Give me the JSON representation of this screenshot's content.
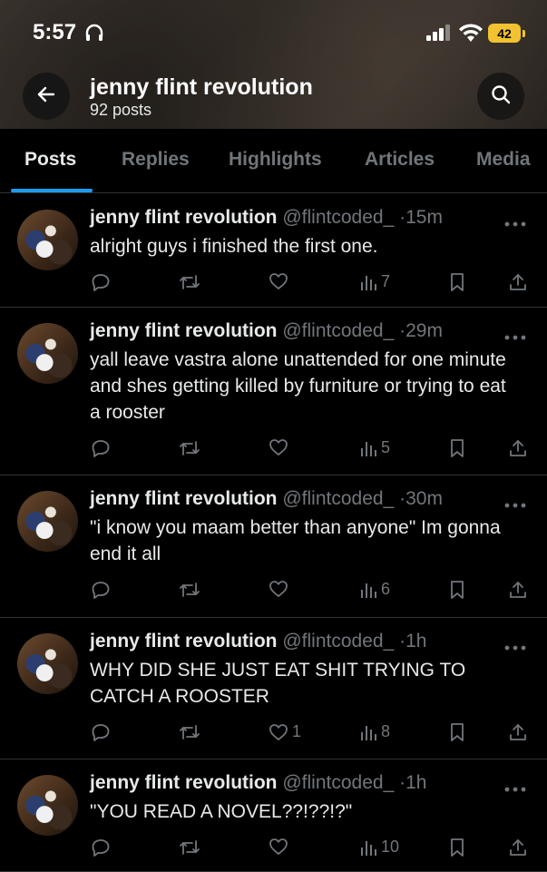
{
  "status": {
    "time": "5:57",
    "battery": "42"
  },
  "profile": {
    "name": "jenny flint revolution",
    "post_count": "92 posts"
  },
  "tabs": [
    "Posts",
    "Replies",
    "Highlights",
    "Articles",
    "Media"
  ],
  "posts": [
    {
      "author": "jenny flint revolution",
      "handle": "@flintcoded_",
      "dot": "·",
      "age": "15m",
      "text": "alright guys i finished the first one.",
      "likes": "",
      "views": "7"
    },
    {
      "author": "jenny flint revolution",
      "handle": "@flintcoded_",
      "dot": "·",
      "age": "29m",
      "text": "yall leave vastra alone unattended for one minute and shes getting killed by furniture or trying to eat a rooster",
      "likes": "",
      "views": "5"
    },
    {
      "author": "jenny flint revolution",
      "handle": "@flintcoded_",
      "dot": "·",
      "age": "30m",
      "text": "\"i know you maam better than anyone\" Im gonna end it all",
      "likes": "",
      "views": "6"
    },
    {
      "author": "jenny flint revolution",
      "handle": "@flintcoded_",
      "dot": "·",
      "age": "1h",
      "text": "WHY DID SHE JUST EAT SHIT TRYING TO CATCH A ROOSTER",
      "likes": "1",
      "views": "8"
    },
    {
      "author": "jenny flint revolution",
      "handle": "@flintcoded_",
      "dot": "·",
      "age": "1h",
      "text": "\"YOU READ A NOVEL??!??!?\"",
      "likes": "",
      "views": "10"
    }
  ],
  "icons": {
    "back": "arrow-left-icon",
    "search": "search-icon",
    "more": "more-icon",
    "reply": "reply-icon",
    "repost": "repost-icon",
    "like": "heart-icon",
    "views": "views-icon",
    "bookmark": "bookmark-icon",
    "share": "share-icon"
  },
  "colors": {
    "accent": "#1d9bf0",
    "battery": "#f2c230",
    "muted": "#71767b",
    "text": "#e7e9ea"
  }
}
